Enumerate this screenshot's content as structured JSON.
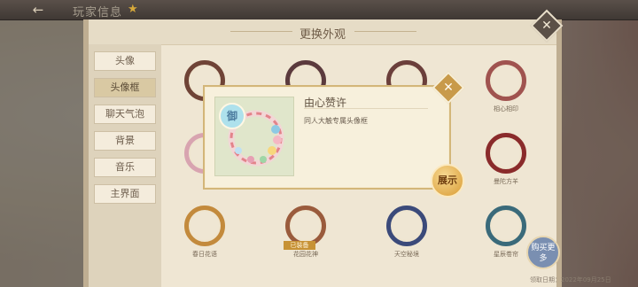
{
  "header": {
    "title": "玩家信息",
    "back_icon": "arrow-left-icon",
    "star_icon": "star-icon"
  },
  "dialog": {
    "title": "更换外观",
    "sidebar": [
      {
        "label": "头像",
        "active": false
      },
      {
        "label": "头像框",
        "active": true
      },
      {
        "label": "聊天气泡",
        "active": false
      },
      {
        "label": "背景",
        "active": false
      },
      {
        "label": "音乐",
        "active": false
      },
      {
        "label": "主界面",
        "active": false
      }
    ],
    "frames": [
      {
        "label": "",
        "color": "#6f4336"
      },
      {
        "label": "",
        "color": "#5b3a3d"
      },
      {
        "label": "",
        "color": "#6b3f3b"
      },
      {
        "label": "相心相印",
        "color": "#a0534f"
      },
      {
        "label": "",
        "color": "#d8a4b0"
      },
      {
        "label": "",
        "color": "#7a6b5f"
      },
      {
        "label": "",
        "color": "#8a7a6b"
      },
      {
        "label": "曼陀方羊",
        "color": "#8a2b2b"
      },
      {
        "label": "春日花语",
        "color": "#c38a3c"
      },
      {
        "label": "花园花神",
        "color": "#9a5b3c"
      },
      {
        "label": "天空秘境",
        "color": "#3b4a7a"
      },
      {
        "label": "星辰卷帘",
        "color": "#3a6a7a"
      }
    ],
    "equipped_tag": "已装备",
    "more_button": "购买更多",
    "date_text": "领取日期：2022年09月25日"
  },
  "popup": {
    "badge": "御",
    "name": "由心赞许",
    "description": "同人大触专属头像框",
    "show_button": "展示",
    "close_icon": "close-icon"
  }
}
